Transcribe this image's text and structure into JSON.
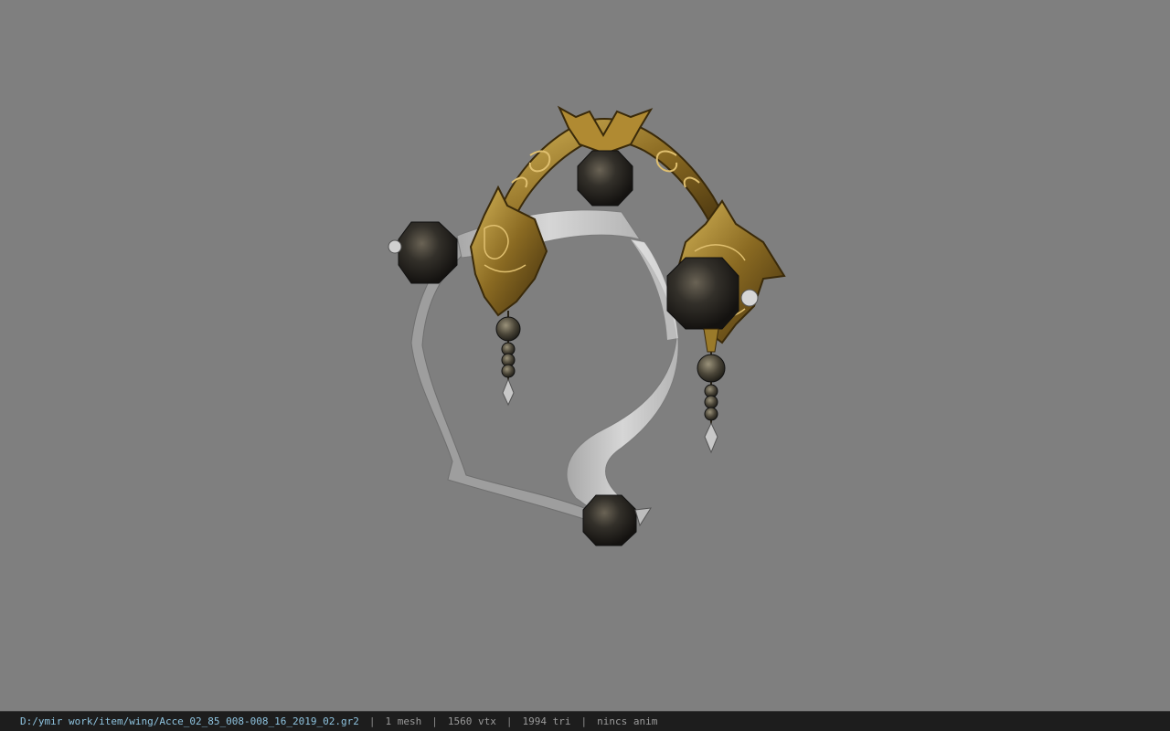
{
  "viewport": {
    "background_color": "#7f7f7f",
    "model": "crown-ribbon-headpiece",
    "colors": {
      "gold": "#8a6a22",
      "gold_dark": "#4a3510",
      "gold_light": "#c9a64a",
      "orb": "#2e2a24",
      "ribbon": "#c8c8c8",
      "ribbon_shade": "#9a9a9a"
    }
  },
  "statusbar": {
    "file_path": "D:/ymir work/item/wing/Acce_02_85_008-008_16_2019_02.gr2",
    "separator": "|",
    "mesh_count": "1 mesh",
    "vertex_count": "1560 vtx",
    "triangle_count": "1994 tri",
    "anim_status": "nincs anim"
  }
}
